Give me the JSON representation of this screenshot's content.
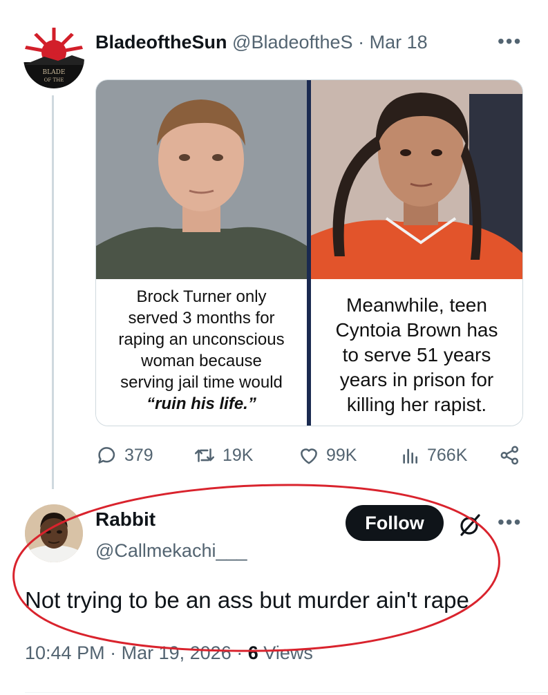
{
  "tweet": {
    "name": "BladeoftheSun",
    "handle": "@BladeoftheS",
    "sep": "·",
    "date": "Mar 18",
    "more": "•••",
    "avatar_text_1": "BLADE",
    "avatar_text_2": "OF THE",
    "media": {
      "left_text_lines": [
        "Brock Turner only",
        "served 3 months for",
        "raping an unconscious",
        "woman because",
        "serving jail time would",
        "“ruin his life.”"
      ],
      "right_text_lines": [
        "Meanwhile, teen",
        "Cyntoia Brown has",
        "to serve 51 years",
        "years in prison for",
        "killing her rapist."
      ]
    },
    "stats": {
      "replies": "379",
      "reposts": "19K",
      "likes": "99K",
      "views": "766K"
    }
  },
  "reply": {
    "name": "Rabbit",
    "handle": "@Callmekachi___",
    "follow_label": "Follow",
    "more": "•••",
    "text": "Not trying to be an ass but murder ain't rape",
    "time": "10:44 PM",
    "sep": "·",
    "date": "Mar 19, 2026",
    "views_count": "6",
    "views_label": "Views"
  },
  "colors": {
    "annotation_circle": "#d9232d",
    "muted_text": "#536471",
    "follow_bg": "#0f1419"
  }
}
